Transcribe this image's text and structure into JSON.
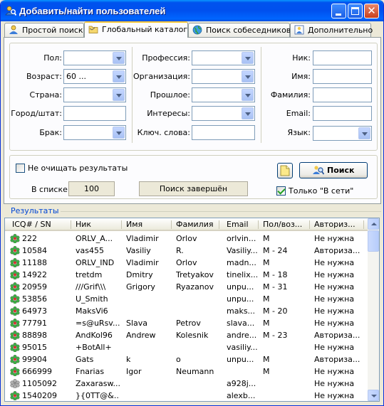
{
  "window": {
    "title": "Добавить/найти пользователей"
  },
  "tabs": [
    {
      "label": "Простой поиск",
      "icon": "user-icon",
      "selected": false
    },
    {
      "label": "Глобальный каталог",
      "icon": "folder-icon",
      "selected": true
    },
    {
      "label": "Поиск собеседников",
      "icon": "globe-icon",
      "selected": false
    },
    {
      "label": "Дополнительно",
      "icon": "user-detail-icon",
      "selected": false
    }
  ],
  "form": {
    "gender_label": "Пол:",
    "gender_value": "",
    "age_label": "Возраст:",
    "age_value": "60 ...",
    "country_label": "Страна:",
    "country_value": "",
    "city_label": "Город/штат:",
    "city_value": "",
    "marital_label": "Брак:",
    "marital_value": "",
    "profession_label": "Профессия:",
    "profession_value": "",
    "organization_label": "Организация:",
    "organization_value": "",
    "past_label": "Прошлое:",
    "past_value": "",
    "interests_label": "Интересы:",
    "interests_value": "",
    "keywords_label": "Ключ. слова:",
    "keywords_value": "",
    "nick_label": "Ник:",
    "nick_value": "",
    "first_name_label": "Имя:",
    "first_name_value": "",
    "last_name_label": "Фамилия:",
    "last_name_value": "",
    "email_label": "Email:",
    "email_value": "",
    "language_label": "Язык:",
    "language_value": ""
  },
  "options": {
    "keep_results_label": "Не очищать результаты",
    "keep_results_checked": false,
    "in_list_label": "В списке:",
    "in_list_count": "100",
    "status_text": "Поиск завершён",
    "search_button": "Поиск",
    "online_only_label": "Только \"В сети\"",
    "online_only_checked": true
  },
  "results": {
    "label": "Результаты",
    "columns": [
      "ICQ# / SN",
      "Ник",
      "Имя",
      "Фамилия",
      "Email",
      "Пол/воз...",
      "Авториз..."
    ],
    "rows": [
      {
        "uin": "222",
        "nick": "ORLV_A...",
        "first": "Vladimir",
        "last": "Orlov",
        "email": "orlvin...",
        "sexage": "M",
        "auth": "Не нужна",
        "online": true
      },
      {
        "uin": "10584",
        "nick": "vas455",
        "first": "Vasiliy",
        "last": "R.",
        "email": "Vasiliy...",
        "sexage": "M - 24",
        "auth": "Авториза...",
        "online": true
      },
      {
        "uin": "11188",
        "nick": "ORLV_IND",
        "first": "Vladimir",
        "last": "Orlov",
        "email": "madn...",
        "sexage": "M",
        "auth": "Не нужна",
        "online": true
      },
      {
        "uin": "14922",
        "nick": "tretdm",
        "first": "Dmitry",
        "last": "Tretyakov",
        "email": "tinelix...",
        "sexage": "M - 18",
        "auth": "Не нужна",
        "online": true
      },
      {
        "uin": "20959",
        "nick": "///Grif\\\\\\",
        "first": "Grigory",
        "last": "Ryazanov",
        "email": "unpu...",
        "sexage": "M - 31",
        "auth": "Не нужна",
        "online": true
      },
      {
        "uin": "53856",
        "nick": "U_Smith",
        "first": "",
        "last": "",
        "email": "unpu...",
        "sexage": "M",
        "auth": "Не нужна",
        "online": true
      },
      {
        "uin": "64973",
        "nick": "MaksVi6",
        "first": "",
        "last": "",
        "email": "maks...",
        "sexage": "M - 20",
        "auth": "Не нужна",
        "online": true
      },
      {
        "uin": "77791",
        "nick": "=s@uRsv...",
        "first": "Slava",
        "last": "Petrov",
        "email": "slava...",
        "sexage": "M",
        "auth": "Не нужна",
        "online": true
      },
      {
        "uin": "88898",
        "nick": "AndKol96",
        "first": "Andrew",
        "last": "Kolesnik",
        "email": "andre...",
        "sexage": "M - 23",
        "auth": "Авториза...",
        "online": true
      },
      {
        "uin": "95015",
        "nick": "+BotAll+",
        "first": "",
        "last": "",
        "email": "vasiliy...",
        "sexage": "",
        "auth": "Не нужна",
        "online": true
      },
      {
        "uin": "99904",
        "nick": "Gats",
        "first": "k",
        "last": "o",
        "email": "unpu...",
        "sexage": "M",
        "auth": "Авториза...",
        "online": true
      },
      {
        "uin": "666999",
        "nick": "Fnarias",
        "first": "Igor",
        "last": "Neumann",
        "email": "",
        "sexage": "M",
        "auth": "Не нужна",
        "online": true
      },
      {
        "uin": "1105092",
        "nick": "Zaxarasw...",
        "first": "",
        "last": "",
        "email": "a928j...",
        "sexage": "",
        "auth": "Не нужна",
        "online": false
      },
      {
        "uin": "1540209",
        "nick": "}{0TT@&...",
        "first": "",
        "last": "",
        "email": "alexb...",
        "sexage": "",
        "auth": "Не нужна",
        "online": true
      }
    ]
  },
  "colors": {
    "titlebar": "#0054e3",
    "online_icon": "#3cb043",
    "offline_icon": "#b0b0b0",
    "group_label": "#0046d5"
  }
}
